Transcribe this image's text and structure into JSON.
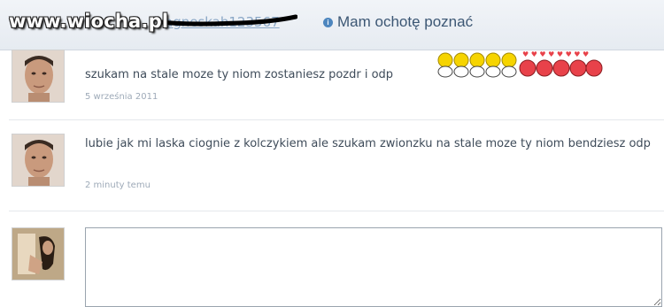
{
  "header": {
    "watermark": "www.wiocha.pl",
    "profile_link": "agneskah123567",
    "action_label": "Mam ochotę poznać",
    "info_icon": "info-icon"
  },
  "messages": [
    {
      "text": "szukam na stale moze ty niom zostaniesz pozdr i odp",
      "date": "5 września 2011"
    },
    {
      "text": "lubie jak mi laska ciognie z kolczykiem ale szukam zwionzku na stale moze ty niom bendziesz odp",
      "date": "2 minuty temu"
    }
  ],
  "compose": {
    "value": "",
    "placeholder": ""
  },
  "colors": {
    "header_bg": "#e9eef4",
    "link": "#8aa7c6",
    "action_text": "#3c5774",
    "message_text": "#3f4c5a",
    "date_text": "#9eaab8"
  }
}
